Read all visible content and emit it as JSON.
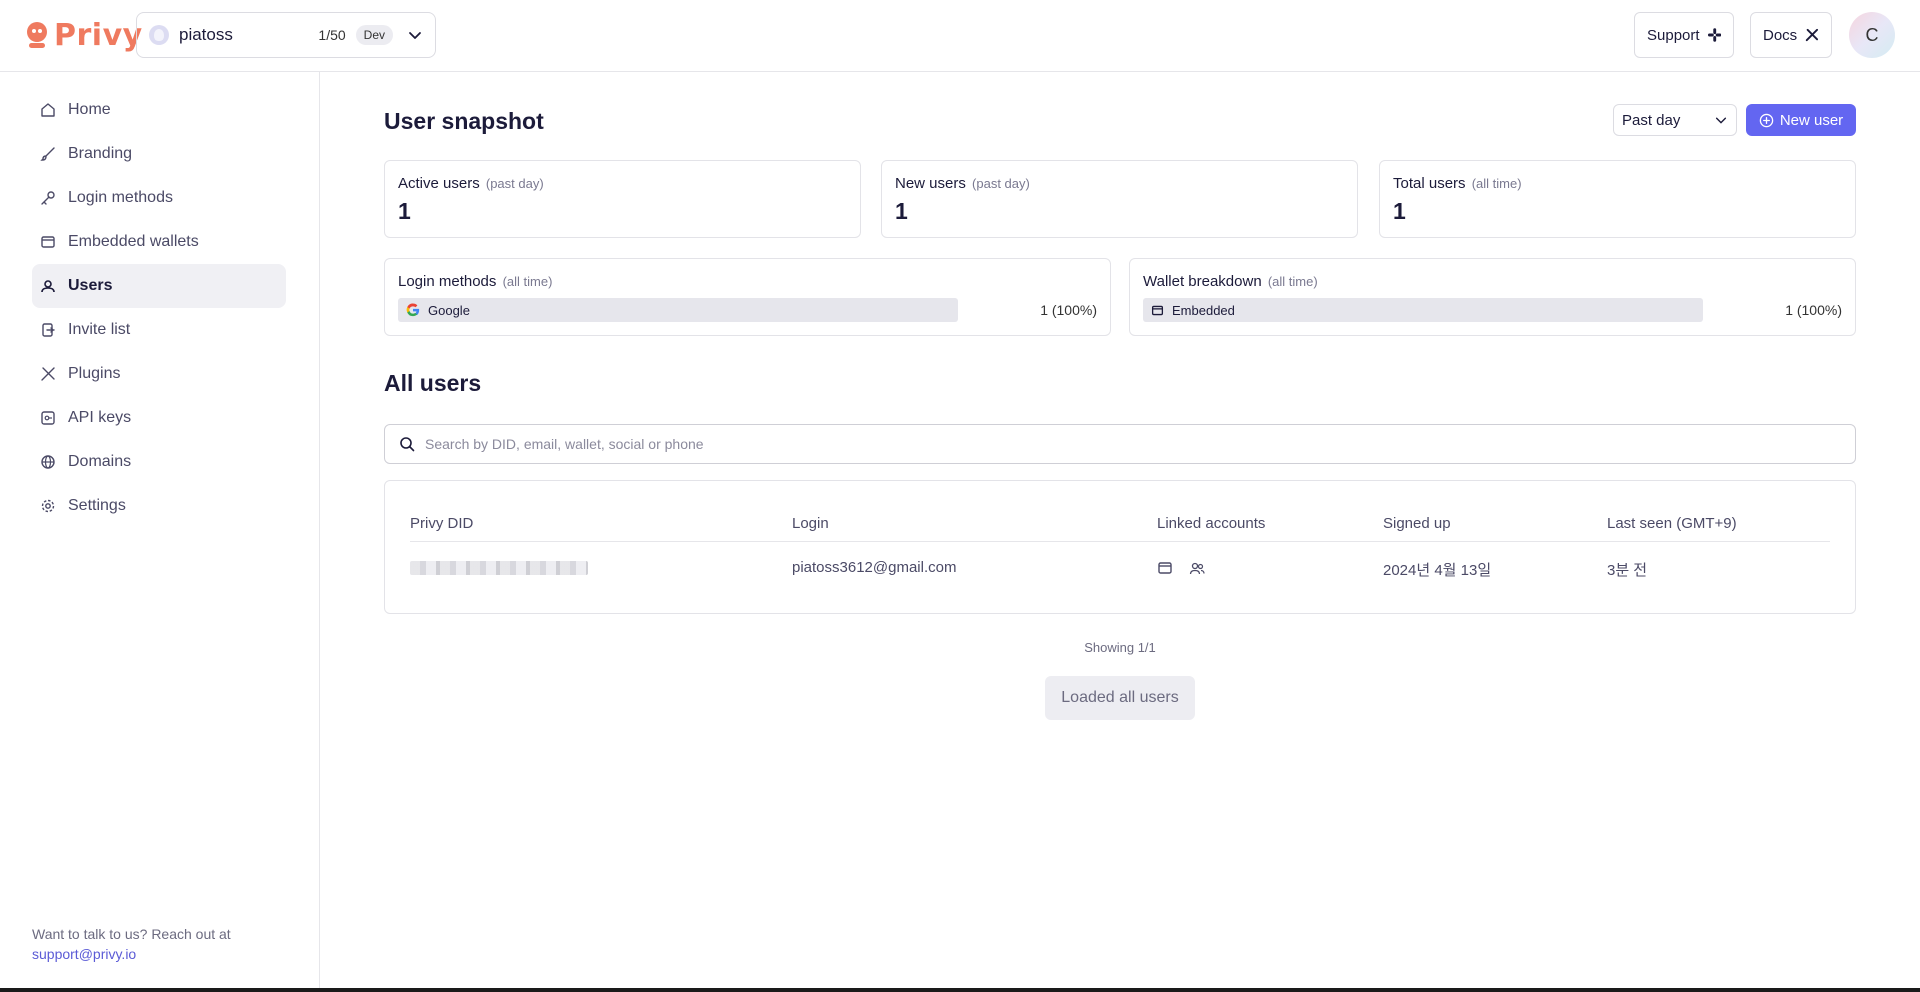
{
  "brand": {
    "name": "Privy",
    "color": "#ef7a5f"
  },
  "app_switcher": {
    "name": "piatoss",
    "count": "1/50",
    "env": "Dev"
  },
  "header": {
    "support_label": "Support",
    "docs_label": "Docs",
    "avatar_initial": "C"
  },
  "sidebar": {
    "items": [
      {
        "label": "Home",
        "icon": "home-icon",
        "active": false
      },
      {
        "label": "Branding",
        "icon": "brush-icon",
        "active": false
      },
      {
        "label": "Login methods",
        "icon": "key-icon",
        "active": false
      },
      {
        "label": "Embedded wallets",
        "icon": "wallet-icon",
        "active": false
      },
      {
        "label": "Users",
        "icon": "users-icon",
        "active": true
      },
      {
        "label": "Invite list",
        "icon": "invite-icon",
        "active": false
      },
      {
        "label": "Plugins",
        "icon": "tools-icon",
        "active": false
      },
      {
        "label": "API keys",
        "icon": "api-key-icon",
        "active": false
      },
      {
        "label": "Domains",
        "icon": "globe-icon",
        "active": false
      },
      {
        "label": "Settings",
        "icon": "gear-icon",
        "active": false
      }
    ],
    "footer_text": "Want to talk to us? Reach out at",
    "footer_email": "support@privy.io"
  },
  "snapshot": {
    "title": "User snapshot",
    "period": "Past day",
    "new_user_label": "New user",
    "stats": [
      {
        "label": "Active users",
        "sub": "(past day)",
        "value": "1"
      },
      {
        "label": "New users",
        "sub": "(past day)",
        "value": "1"
      },
      {
        "label": "Total users",
        "sub": "(all time)",
        "value": "1"
      }
    ],
    "login_methods": {
      "label": "Login methods",
      "sub": "(all time)",
      "item": "Google",
      "value": "1 (100%)",
      "share": 1.0
    },
    "wallet_breakdown": {
      "label": "Wallet breakdown",
      "sub": "(all time)",
      "item": "Embedded",
      "value": "1 (100%)",
      "share": 1.0
    }
  },
  "users": {
    "title": "All users",
    "search_placeholder": "Search by DID, email, wallet, social or phone",
    "columns": [
      "Privy DID",
      "Login",
      "Linked accounts",
      "Signed up",
      "Last seen (GMT+9)"
    ],
    "rows": [
      {
        "login": "piatoss3612@gmail.com",
        "signed_up": "2024년 4월 13일",
        "last_seen": "3분 전"
      }
    ],
    "showing": "Showing 1/1",
    "loaded_label": "Loaded all users"
  },
  "colors": {
    "accent": "#6366f1",
    "link": "#5b5bd6"
  }
}
